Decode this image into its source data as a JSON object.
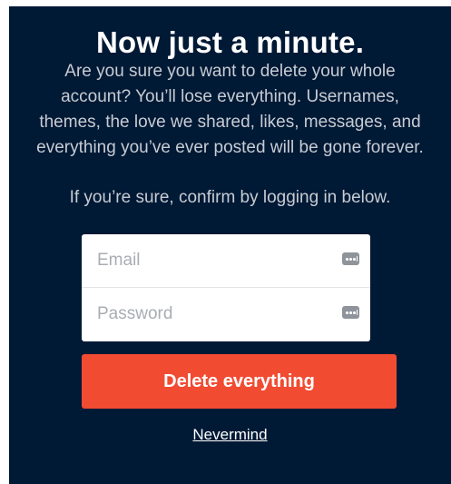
{
  "dialog": {
    "title": "Now just a minute.",
    "warning": "Are you sure you want to delete your whole account? You’ll lose everything. Usernames, themes, the love we shared, likes, messages, and everything you’ve ever posted will be gone forever.",
    "confirm_prompt": "If you’re sure, confirm by logging in below."
  },
  "form": {
    "email": {
      "placeholder": "Email",
      "value": ""
    },
    "password": {
      "placeholder": "Password",
      "value": ""
    },
    "autofill_icon": "password-manager-key-icon"
  },
  "actions": {
    "delete_label": "Delete everything",
    "cancel_label": "Nevermind"
  },
  "colors": {
    "background": "#001935",
    "danger_button": "#f14b32",
    "text": "#ffffff",
    "muted_text": "#c7ccd3"
  }
}
